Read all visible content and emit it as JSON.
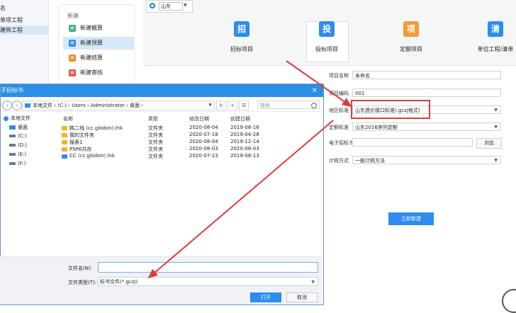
{
  "left_panel": {
    "header": "名",
    "items": [
      {
        "label": "单项工程",
        "selected": false
      },
      {
        "label": "建筑工程",
        "selected": true
      }
    ]
  },
  "new_menu": {
    "title": "新建",
    "items": [
      {
        "label": "新建概算",
        "color": "#3bb07a"
      },
      {
        "label": "新建预算",
        "color": "#2d8cf0"
      },
      {
        "label": "新建结算",
        "color": "#f08a24"
      },
      {
        "label": "新建审核",
        "color": "#e5534b"
      }
    ]
  },
  "province": {
    "value": "山东"
  },
  "top_items": [
    {
      "label": "招标项目",
      "glyph": "招",
      "color": "#2d8cf0"
    },
    {
      "label": "投标项目",
      "glyph": "投",
      "color": "#2d8cf0"
    },
    {
      "label": "定额项目",
      "glyph": "项",
      "color": "#f39c34"
    },
    {
      "label": "单位工程/清单",
      "glyph": "清",
      "color": "#2d8cf0"
    }
  ],
  "form": {
    "project_name_label": "项目名称",
    "project_name": "未命名",
    "project_code_label": "项目编码",
    "project_code": "001",
    "region_label": "地区标准",
    "region_value": "山东造价接口标准(.gczj格式)",
    "quota_label": "定额标准",
    "quota_value": "山东2016序列定额",
    "tender_file_label": "电子招标书",
    "tender_file_value": "",
    "browse_label": "浏览",
    "tax_label": "计税方式",
    "tax_value": "一般计税方法",
    "create_label": "立即新建"
  },
  "dialog": {
    "title": "子招标书",
    "close": "×",
    "address": "本地文件 › (C:) › Users › Administrator › 桌面 ›",
    "search_placeholder": "搜索",
    "nav": [
      {
        "label": "本地文件",
        "color": "#2a8fe6"
      },
      {
        "label": "桌面",
        "color": "#2a8fe6"
      },
      {
        "label": "(C:)",
        "color": "#6b7a8c"
      },
      {
        "label": "(D:)",
        "color": "#6b7a8c"
      },
      {
        "label": "(E:)",
        "color": "#6b7a8c"
      },
      {
        "label": "(F:)",
        "color": "#6b7a8c"
      }
    ],
    "columns": [
      "名称",
      "类型",
      "修改日期",
      "创建日期"
    ],
    "files": [
      {
        "name": "韩二线 (cc.glodon).lnk",
        "type": "文件夹",
        "modified": "2020-08-04",
        "created": "2019-08-16",
        "color": "#f0b429"
      },
      {
        "name": "我的文件夹",
        "type": "文件夹",
        "modified": "2020-07-18",
        "created": "2019-04-28",
        "color": "#f0b429"
      },
      {
        "name": "报表1",
        "type": "文件夹",
        "modified": "2020-08-04",
        "created": "2019-12-14",
        "color": "#f0b429"
      },
      {
        "name": "P5P6共存",
        "type": "文件夹",
        "modified": "2020-08-03",
        "created": "2020-08-03",
        "color": "#f0b429"
      },
      {
        "name": "CC (cc.glodon).lnk",
        "type": "文件夹",
        "modified": "2020-07-23",
        "created": "2019-08-13",
        "color": "#2d8cf0"
      }
    ],
    "filename_label": "文件名(N):",
    "filename_value": "",
    "filetype_label": "文件类型(T):",
    "filetype_value": "标书文件(*.gczj)",
    "open_label": "打开",
    "cancel_label": "取消"
  },
  "colors": {
    "accent": "#2d8cf0",
    "title_bar": "#2a8fe6",
    "highlight": "#e03a3a"
  }
}
